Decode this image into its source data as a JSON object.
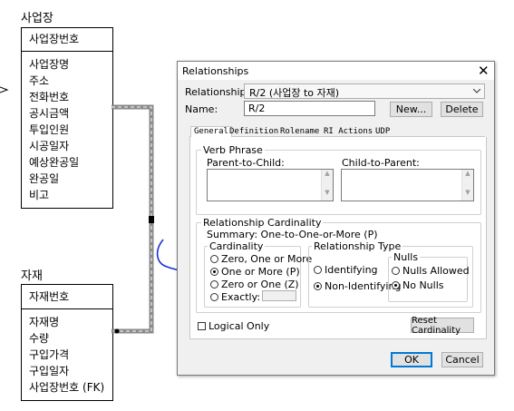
{
  "er": {
    "entity1": {
      "title": "사업장",
      "key": "사업장번호",
      "attributes": [
        "사업장명",
        "주소",
        "전화번호",
        "공시금액",
        "투입인원",
        "시공일자",
        "예상완공일",
        "완공일",
        "비고"
      ]
    },
    "entity2": {
      "title": "자재",
      "key": "자재번호",
      "attributes": [
        "자재명",
        "수량",
        "구입가격",
        "구입일자",
        "사업장번호 (FK)"
      ]
    }
  },
  "dialog": {
    "title": "Relationships",
    "close_glyph": "✕",
    "relationship_label": "Relationship:",
    "relationship_value": "R/2 (사업장 to 자재)",
    "name_label": "Name:",
    "name_value": "R/2",
    "new_button": "New...",
    "delete_button": "Delete",
    "tabs": [
      "General",
      "Definition",
      "Rolename",
      "RI Actions",
      "UDP"
    ],
    "active_tab": "General",
    "verb_phrase": {
      "group_label": "Verb Phrase",
      "parent_to_child_label": "Parent-to-Child:",
      "child_to_parent_label": "Child-to-Parent:"
    },
    "cardinality_group": {
      "label": "Relationship Cardinality",
      "summary": "Summary:  One-to-One-or-More (P)",
      "cardinality_label": "Cardinality",
      "options": [
        "Zero, One or More",
        "One or More (P)",
        "Zero or One (Z)",
        "Exactly:"
      ],
      "selected": "One or More (P)"
    },
    "relationship_type": {
      "label": "Relationship Type",
      "options": [
        "Identifying",
        "Non-Identifying"
      ],
      "selected": "Non-Identifying"
    },
    "nulls": {
      "label": "Nulls",
      "options": [
        "Nulls Allowed",
        "No Nulls"
      ],
      "selected": "No Nulls"
    },
    "logical_only_label": "Logical Only",
    "logical_only_checked": false,
    "reset_button": "Reset Cardinality",
    "ok_button": "OK",
    "cancel_button": "Cancel"
  },
  "colors": {
    "annotation_ink": "#1a2fd6",
    "connector_gray": "#8a8a8a",
    "default_button_border": "#0078d7"
  }
}
